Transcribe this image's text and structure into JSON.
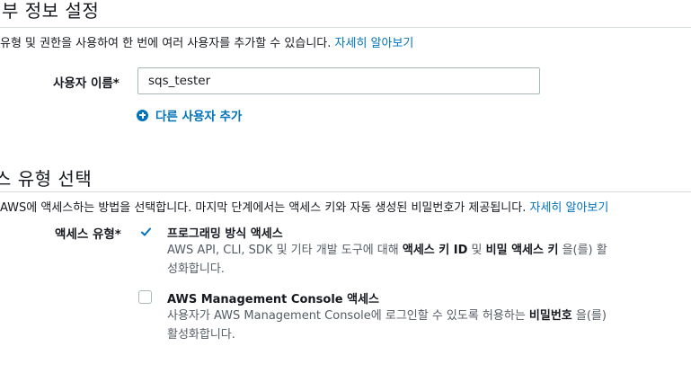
{
  "user_details": {
    "title": "부 정보 설정",
    "description": "유형 및 권한을 사용하여 한 번에 여러 사용자를 추가할 수 있습니다.",
    "learn_more": "자세히 알아보기",
    "username_label": "사용자 이름*",
    "username_value": "sqs_tester",
    "add_user_label": "다른 사용자 추가",
    "add_user_icon": "plus-circle-icon"
  },
  "access_type": {
    "title": "스 유형 선택",
    "description": "AWS에 액세스하는 방법을 선택합니다. 마지막 단계에서는 액세스 키와 자동 생성된 비밀번호가 제공됩니다.",
    "learn_more": "자세히 알아보기",
    "label": "액세스 유형*",
    "options": [
      {
        "title": "프로그래밍 방식 액세스",
        "checked": true,
        "desc_prefix": "AWS API, CLI, SDK 및 기타 개발 도구에 대해 ",
        "desc_bold1": "액세스 키 ID",
        "desc_mid": " 및 ",
        "desc_bold2": "비밀 액세스 키",
        "desc_suffix_line1": " 을(를) 활",
        "desc_line2": "성화합니다."
      },
      {
        "title": "AWS Management Console 액세스",
        "checked": false,
        "desc_prefix": "사용자가 AWS Management Console에 로그인할 수 있도록 허용하는 ",
        "desc_bold1": "비밀번호",
        "desc_suffix_line1": " 을(를)",
        "desc_line2": "활성화합니다."
      }
    ]
  },
  "colors": {
    "link": "#0073bb",
    "checkbox_check": "#0073bb",
    "divider": "#d5dbdb"
  }
}
